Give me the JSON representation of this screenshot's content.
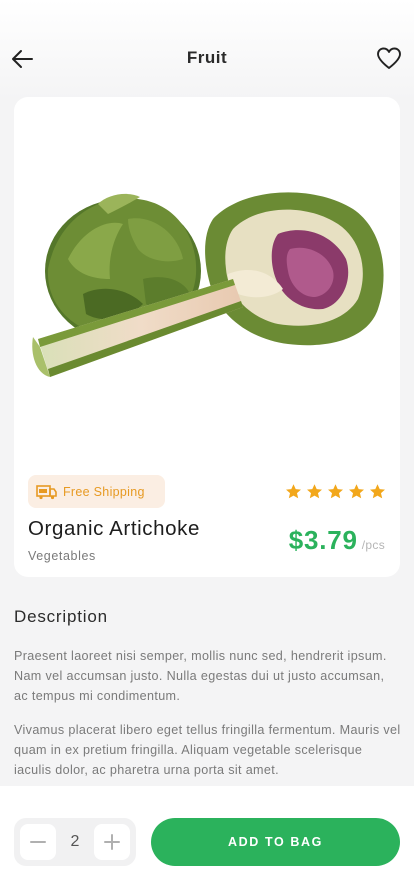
{
  "header": {
    "title": "Fruit",
    "back_icon": "arrow-left-icon",
    "favorite_icon": "heart-icon"
  },
  "product": {
    "image": "artichoke-photo",
    "shipping_badge": {
      "label": "Free Shipping",
      "icon": "free-shipping-truck-icon"
    },
    "rating": {
      "stars": 5,
      "max": 5,
      "icon": "star-icon"
    },
    "name": "Organic Artichoke",
    "category": "Vegetables",
    "price": "$3.79",
    "unit": "/pcs"
  },
  "description": {
    "heading": "Description",
    "paragraphs": [
      "Praesent laoreet nisi semper, mollis nunc sed, hendrerit ipsum. Nam vel accumsan justo. Nulla egestas dui ut justo accumsan, ac tempus mi condimentum.",
      "Vivamus placerat libero eget tellus fringilla fermentum. Mauris vel quam in ex pretium fringilla. Aliquam vegetable scelerisque iaculis dolor, ac pharetra urna porta sit amet."
    ]
  },
  "cart": {
    "quantity": "2",
    "add_label": "ADD TO BAG",
    "minus_icon": "minus-icon",
    "plus_icon": "plus-icon"
  },
  "colors": {
    "accent": "#2bb25c",
    "badge_bg": "#fbeee3",
    "badge_text": "#e79a23",
    "star": "#f2a71b",
    "background": "#f4f4f5"
  }
}
